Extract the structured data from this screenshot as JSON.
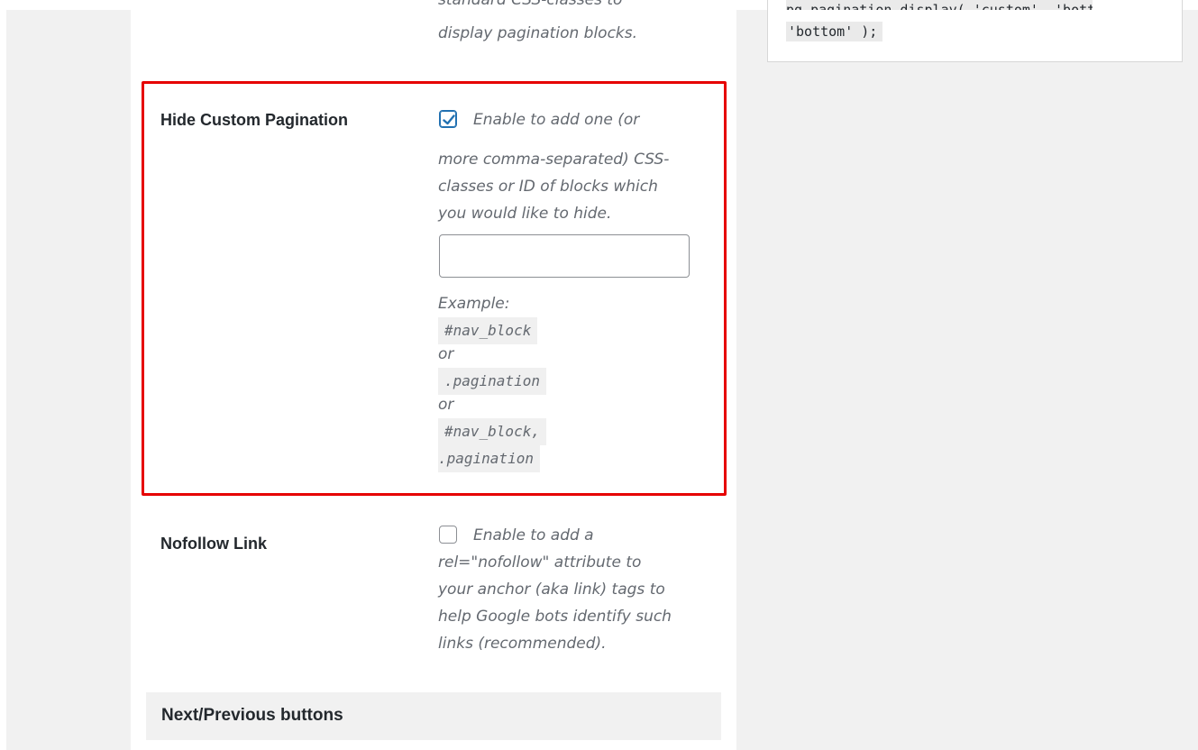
{
  "top_partial": {
    "desc_line1": "standard CSS-classes to",
    "desc_line2": "display pagination blocks."
  },
  "sidebar_code": {
    "line1": "pg_pagination_display( 'custom', 'bottom'",
    "line2": "'bottom' );"
  },
  "hide_custom_pagination": {
    "label": "Hide Custom Pagination",
    "checked": true,
    "desc_line1": "Enable to add one (or",
    "desc_line2": "more comma-separated) CSS-",
    "desc_line3": "classes or ID of blocks which",
    "desc_line4": "you would like to hide.",
    "input_value": "",
    "example_label": "Example:",
    "example_1": "#nav_block",
    "or_1": "or",
    "example_2": ".pagination",
    "or_2": "or",
    "example_3a": "#nav_block,",
    "example_3b": ".pagination"
  },
  "nofollow_link": {
    "label": "Nofollow Link",
    "checked": false,
    "desc_line1": "Enable to add a",
    "desc_line2": "rel=\"nofollow\" attribute to",
    "desc_line3": "your anchor (aka link) tags to",
    "desc_line4": "help Google bots identify such",
    "desc_line5": "links (recommended)."
  },
  "next_prev_section": {
    "title": "Next/Previous buttons"
  },
  "colors": {
    "highlight": "#e60000",
    "checkbox_accent": "#2271b1"
  }
}
